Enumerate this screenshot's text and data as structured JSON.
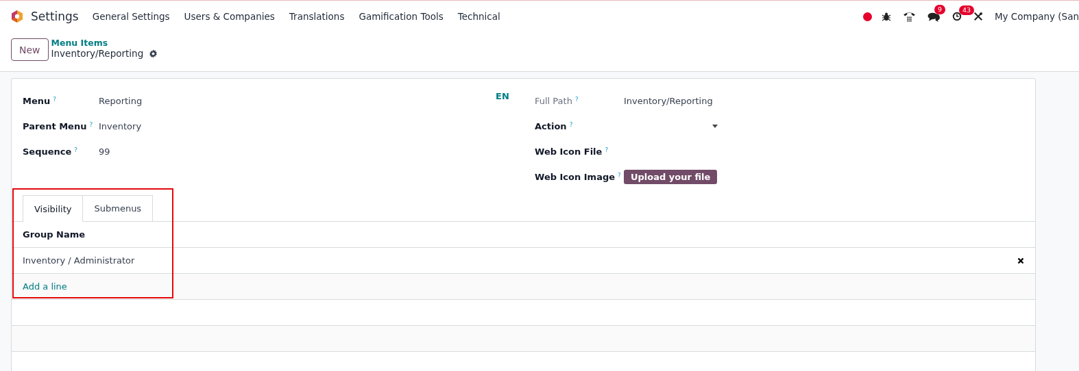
{
  "navbar": {
    "app_name": "Settings",
    "menu": [
      "General Settings",
      "Users & Companies",
      "Translations",
      "Gamification Tools",
      "Technical"
    ],
    "messages_count": "9",
    "activities_count": "43",
    "company": "My Company (San"
  },
  "control_panel": {
    "new_button": "New",
    "breadcrumb": "Menu Items",
    "record_title": "Inventory/Reporting"
  },
  "form": {
    "left_fields": [
      {
        "label": "Menu",
        "help": "?",
        "value": "Reporting"
      },
      {
        "label": "Parent Menu",
        "help": "?",
        "value": "Inventory"
      },
      {
        "label": "Sequence",
        "help": "?",
        "value": "99"
      }
    ],
    "language": "EN",
    "right_fields": [
      {
        "kind": "readonly",
        "label": "Full Path",
        "help": "?",
        "value": "Inventory/Reporting"
      },
      {
        "kind": "select",
        "label": "Action",
        "help": "?"
      },
      {
        "kind": "text",
        "label": "Web Icon File",
        "help": "?"
      },
      {
        "kind": "upload",
        "label": "Web Icon Image",
        "help": "?",
        "button": "Upload your file"
      }
    ]
  },
  "tabs": [
    {
      "label": "Visibility",
      "selected": true
    },
    {
      "label": "Submenus",
      "selected": false
    }
  ],
  "table": {
    "columns": [
      "Group Name"
    ],
    "rows": [
      {
        "cells": [
          "Inventory / Administrator"
        ]
      }
    ],
    "add_line": "Add a line"
  }
}
